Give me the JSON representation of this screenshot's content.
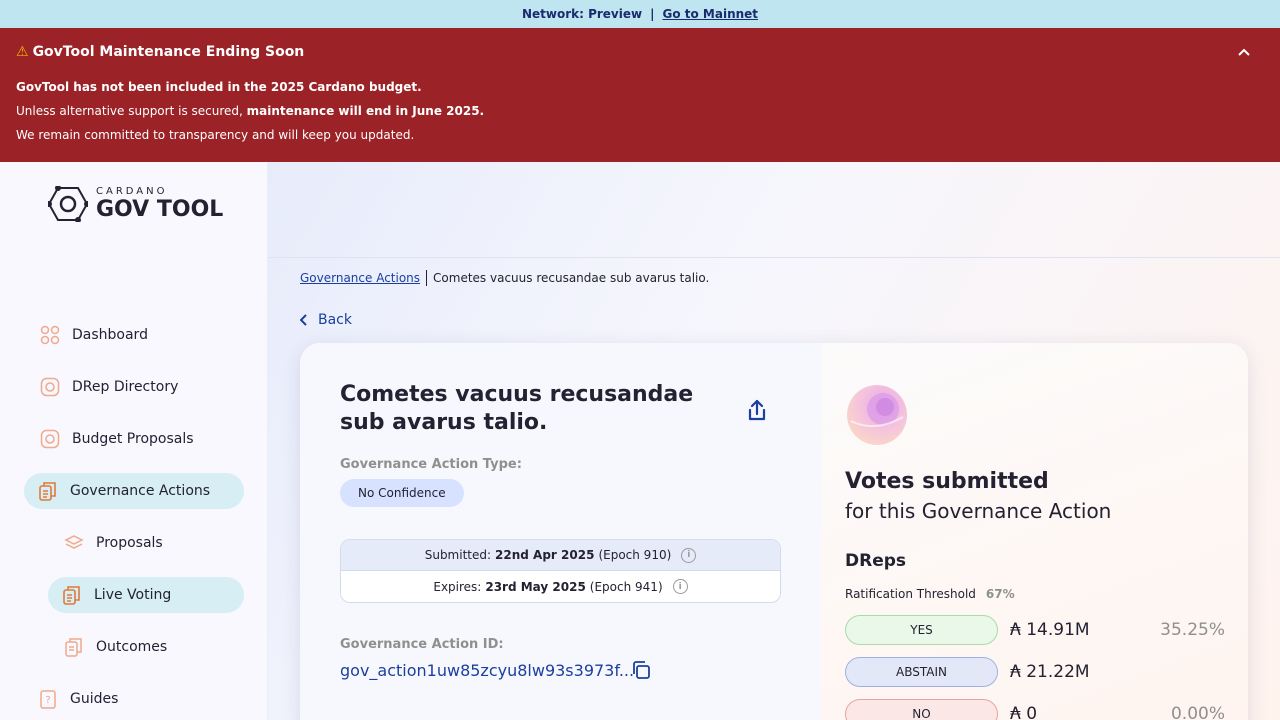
{
  "network": {
    "label": "Network: Preview",
    "separator": "|",
    "link": "Go to Mainnet"
  },
  "banner": {
    "title": "GovTool Maintenance Ending Soon",
    "line1": "GovTool has not been included in the 2025 Cardano budget.",
    "line2_prefix": "Unless alternative support is secured,",
    "line2_bold": "maintenance will end in June 2025.",
    "line3": "We remain committed to transparency and will keep you updated.",
    "bg_color": "#9b2226"
  },
  "logo": {
    "small": "CARDANO",
    "big": "GOV TOOL"
  },
  "sidebar": {
    "items": [
      {
        "label": "Dashboard",
        "icon": "dashboard-icon"
      },
      {
        "label": "DRep Directory",
        "icon": "drep-directory-icon"
      },
      {
        "label": "Budget Proposals",
        "icon": "budget-icon"
      },
      {
        "label": "Governance Actions",
        "icon": "governance-icon",
        "active": true
      },
      {
        "label": "Proposals",
        "icon": "layers-icon",
        "sub": true
      },
      {
        "label": "Live Voting",
        "icon": "voting-icon",
        "sub": true,
        "active": true
      },
      {
        "label": "Outcomes",
        "icon": "outcomes-icon",
        "sub": true
      },
      {
        "label": "Guides",
        "icon": "guides-icon"
      }
    ]
  },
  "breadcrumb": {
    "root": "Governance Actions",
    "current": "Cometes vacuus recusandae sub avarus talio."
  },
  "back_label": "Back",
  "action": {
    "title": "Cometes vacuus recusandae sub avarus talio.",
    "type_label": "Governance Action Type:",
    "type_value": "No Confidence",
    "submitted_label": "Submitted:",
    "submitted_date": "22nd Apr 2025",
    "submitted_epoch": "(Epoch 910)",
    "expires_label": "Expires:",
    "expires_date": "23rd May 2025",
    "expires_epoch": "(Epoch 941)",
    "id_label": "Governance Action ID:",
    "id_value": "gov_action1uw85zcyu8lw93s3973f..."
  },
  "votes": {
    "title": "Votes submitted",
    "subtitle": "for this Governance Action",
    "section": "DReps",
    "threshold_label": "Ratification Threshold",
    "threshold_value": "67%",
    "rows": [
      {
        "label": "YES",
        "amount": "₳ 14.91M",
        "percent": "35.25%"
      },
      {
        "label": "ABSTAIN",
        "amount": "₳ 21.22M",
        "percent": ""
      },
      {
        "label": "NO",
        "amount": "₳ 0",
        "percent": "0.00%"
      }
    ]
  },
  "colors": {
    "accent": "#1a3fa0",
    "active_nav": "#d6eef4",
    "netbar": "#bfe5f1"
  }
}
